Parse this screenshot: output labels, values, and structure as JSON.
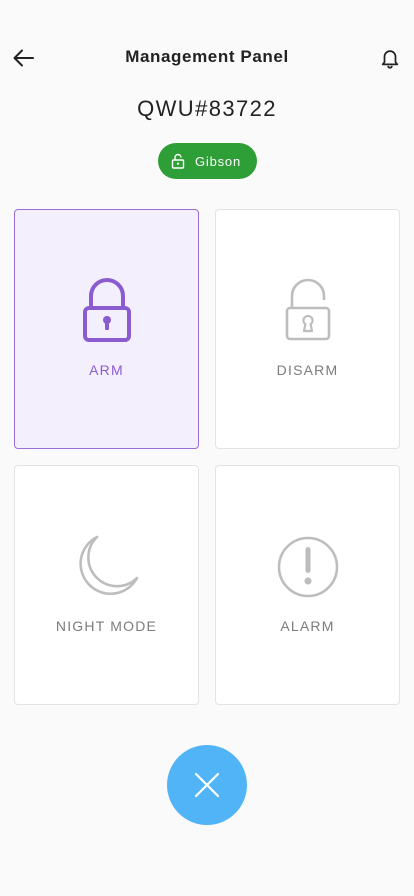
{
  "header": {
    "title": "Management Panel",
    "back_icon": "arrow-left-icon",
    "notification_icon": "bell-icon"
  },
  "device": {
    "id": "QWU#83722",
    "user_badge": {
      "label": "Gibson",
      "icon": "lock-open-icon",
      "color": "#2e9e36"
    }
  },
  "modes": [
    {
      "label": "ARM",
      "icon": "lock-closed-icon",
      "selected": true
    },
    {
      "label": "DISARM",
      "icon": "lock-open-icon",
      "selected": false
    },
    {
      "label": "NIGHT MODE",
      "icon": "moon-icon",
      "selected": false
    },
    {
      "label": "ALARM",
      "icon": "alert-circle-icon",
      "selected": false
    }
  ],
  "colors": {
    "accent": "#8a5cd0",
    "selected_bg": "#f4effd",
    "inactive_icon": "#bdbdbd",
    "fab": "#51b4f6"
  },
  "fab": {
    "icon": "close-icon"
  }
}
